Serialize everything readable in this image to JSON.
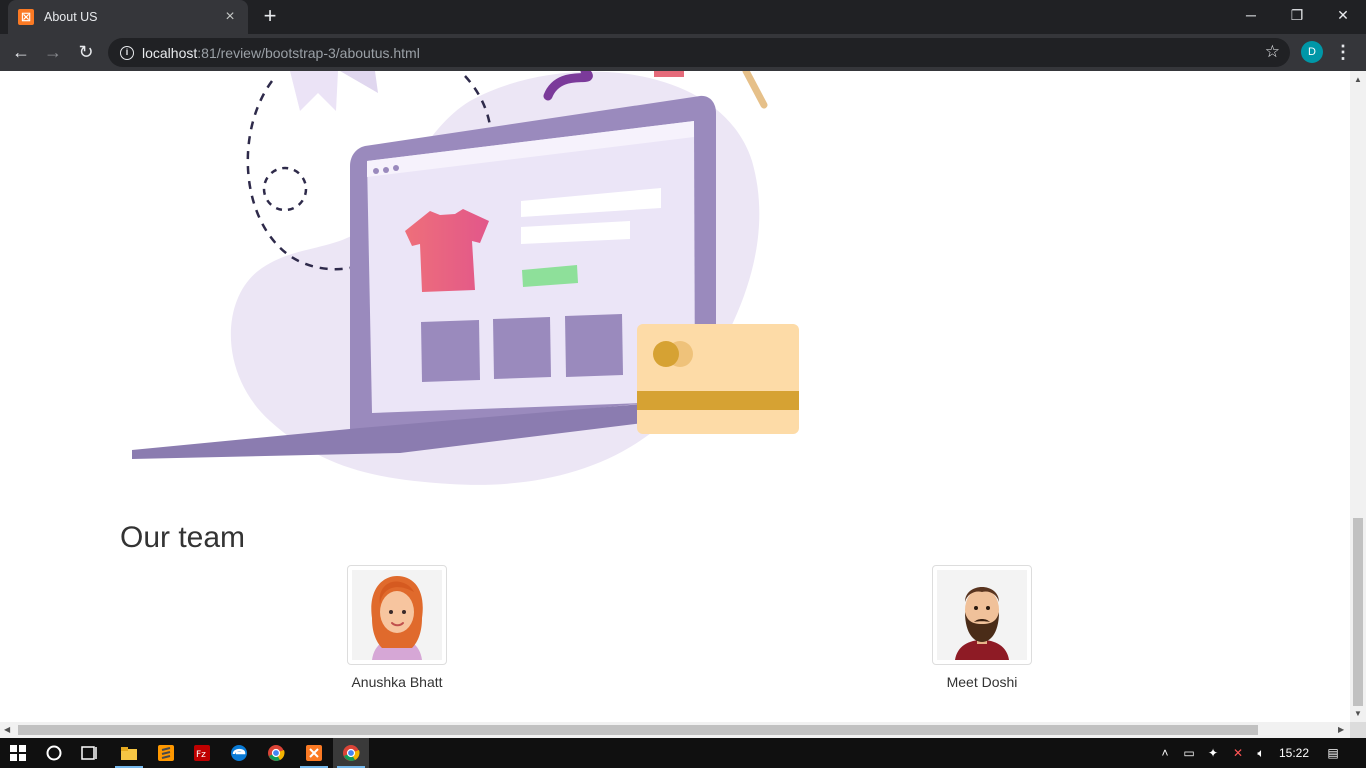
{
  "browser": {
    "tab_title": "About US",
    "tab_favicon": "xampp-icon",
    "new_tab": "+",
    "url_host": "localhost",
    "url_rest": ":81/review/bootstrap-3/aboutus.html",
    "profile_initial": "D"
  },
  "page": {
    "illustration": "online-shopping-laptop-illustration",
    "team_heading": "Our team",
    "members": [
      {
        "name": "Anushka Bhatt",
        "avatar": "female-avatar"
      },
      {
        "name": "Meet Doshi",
        "avatar": "male-avatar"
      }
    ]
  },
  "taskbar": {
    "apps": [
      "start-icon",
      "cortana-icon",
      "task-view-icon",
      "file-explorer-icon",
      "sublime-text-icon",
      "filezilla-icon",
      "edge-icon",
      "chrome-icon",
      "xampp-icon",
      "chrome-active-icon"
    ],
    "clock": "15:22"
  },
  "colors": {
    "chrome_dark": "#202124",
    "chrome_toolbar": "#35363a",
    "laptop_purple": "#9a8abd",
    "blob_lavender": "#ece6f5",
    "card_peach": "#fddba7",
    "card_stripe": "#d6a233"
  }
}
